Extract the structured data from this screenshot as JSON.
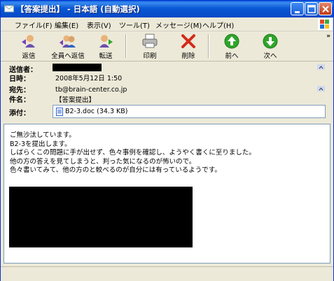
{
  "window": {
    "title": "【答案提出】 - 日本語 (自動選択)",
    "title_bar_color": "#0a58d4"
  },
  "menu": [
    "ファイル(F)",
    "編集(E)",
    "表示(V)",
    "ツール(T)",
    "メッセージ(M)",
    "ヘルプ(H)"
  ],
  "toolbar": {
    "reply": "返信",
    "reply_all": "全員へ返信",
    "forward": "転送",
    "print": "印刷",
    "delete": "削除",
    "previous": "前へ",
    "next": "次へ",
    "more": "»"
  },
  "header": {
    "from_label": "送信者：",
    "date_label": "日時：",
    "date_value": "2008年5月12日 1:50",
    "to_label": "宛先：",
    "to_value": "tb@brain-center.co.jp",
    "subject_label": "件名：",
    "subject_value": "【答案提出】",
    "attach_label": "添付：",
    "attach_value": "B2-3.doc (34.3 KB)"
  },
  "body": {
    "lines": [
      "ご無沙汰しています。",
      "B2-3を提出します。",
      "しばらくこの問題に手が出せず、色々事例を確認し、ようやく書くに至りました。",
      "他の方の答えを見てしまうと、判った気になるのが怖いので。",
      "色々書いてみて、他の方のと較べるのが自分には有っているようです。"
    ]
  },
  "colors": {
    "green_arrow": "#2fa52a",
    "delete_red": "#d42a1a",
    "close_button": "#c13b18"
  }
}
